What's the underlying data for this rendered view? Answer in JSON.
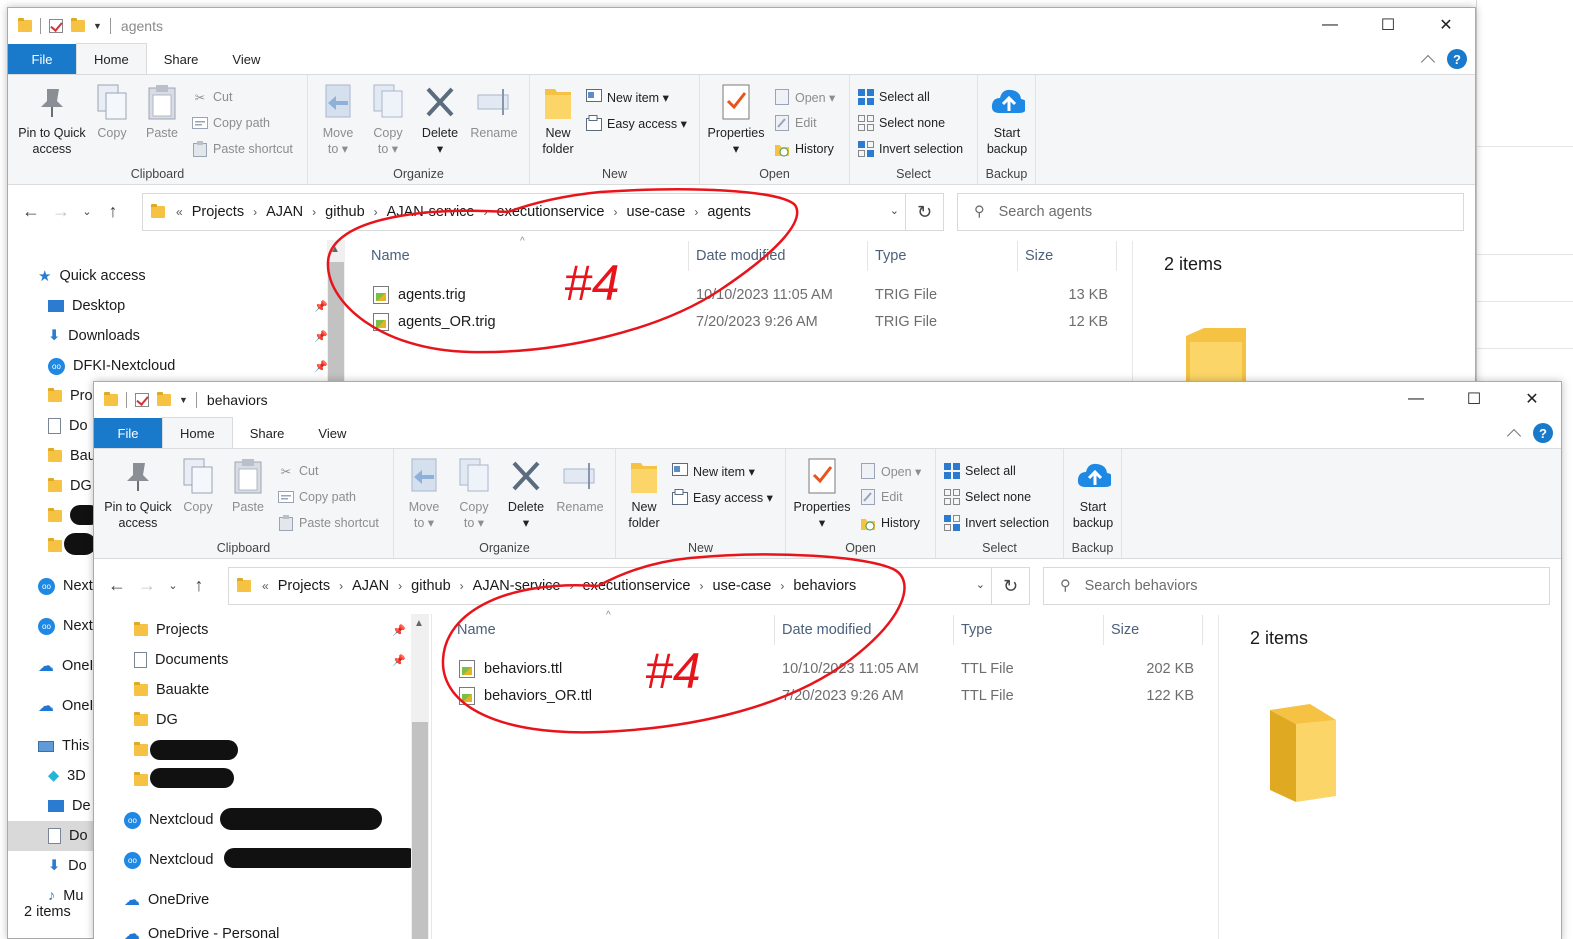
{
  "windows": [
    {
      "title": "agents",
      "tabs": [
        "File",
        "Home",
        "Share",
        "View"
      ],
      "ribbon": {
        "clipboard": {
          "label": "Clipboard",
          "pin": "Pin to Quick\naccess",
          "copy": "Copy",
          "paste": "Paste",
          "cut": "Cut",
          "copy_path": "Copy path",
          "paste_shortcut": "Paste shortcut"
        },
        "organize": {
          "label": "Organize",
          "move_to": "Move\nto ▾",
          "copy_to": "Copy\nto ▾",
          "delete": "Delete\n▾",
          "rename": "Rename"
        },
        "new": {
          "label": "New",
          "new_folder": "New\nfolder",
          "new_item": "New item ▾",
          "easy_access": "Easy access ▾"
        },
        "open": {
          "label": "Open",
          "properties": "Properties\n▾",
          "open": "Open ▾",
          "edit": "Edit",
          "history": "History"
        },
        "select": {
          "label": "Select",
          "select_all": "Select all",
          "select_none": "Select none",
          "invert_selection": "Invert selection"
        },
        "backup": {
          "label": "Backup",
          "start_backup": "Start\nbackup"
        }
      },
      "breadcrumb_prefix": "«",
      "breadcrumbs": [
        "Projects",
        "AJAN",
        "github",
        "AJAN-service",
        "executionservice",
        "use-case",
        "agents"
      ],
      "search_placeholder": "Search agents",
      "columns": [
        "Name",
        "Date modified",
        "Type",
        "Size"
      ],
      "files": [
        {
          "name": "agents.trig",
          "date": "10/10/2023 11:05 AM",
          "type": "TRIG File",
          "size": "13 KB"
        },
        {
          "name": "agents_OR.trig",
          "date": "7/20/2023 9:26 AM",
          "type": "TRIG File",
          "size": "12 KB"
        }
      ],
      "item_count": "2 items",
      "nav": [
        {
          "label": "Quick access",
          "icon": "star-icon"
        },
        {
          "label": "Desktop",
          "icon": "desktop-icon",
          "pinned": true
        },
        {
          "label": "Downloads",
          "icon": "download-icon",
          "pinned": true
        },
        {
          "label": "DFKI-Nextcloud",
          "icon": "nextcloud-icon",
          "pinned": true
        },
        {
          "label": "Pro",
          "icon": "folder-icon"
        },
        {
          "label": "Do",
          "icon": "document-icon"
        },
        {
          "label": "Bau",
          "icon": "folder-icon"
        },
        {
          "label": "DG",
          "icon": "folder-icon"
        },
        {
          "label": "",
          "icon": "folder-icon"
        },
        {
          "label": "",
          "icon": "folder-icon"
        },
        {
          "label": "Next",
          "icon": "nextcloud-icon"
        },
        {
          "label": "Next",
          "icon": "nextcloud-icon"
        },
        {
          "label": "OneI",
          "icon": "onedrive-icon"
        },
        {
          "label": "OneI",
          "icon": "onedrive-icon"
        },
        {
          "label": "This",
          "icon": "computer-icon"
        },
        {
          "label": "3D",
          "icon": "cube-icon"
        },
        {
          "label": "De",
          "icon": "desktop-icon"
        },
        {
          "label": "Do",
          "icon": "document-icon"
        },
        {
          "label": "Do",
          "icon": "download-icon"
        },
        {
          "label": "Mu",
          "icon": "music-icon"
        }
      ],
      "status": "2 items"
    },
    {
      "title": "behaviors",
      "tabs": [
        "File",
        "Home",
        "Share",
        "View"
      ],
      "ribbon": {
        "clipboard": {
          "label": "Clipboard",
          "pin": "Pin to Quick\naccess",
          "copy": "Copy",
          "paste": "Paste",
          "cut": "Cut",
          "copy_path": "Copy path",
          "paste_shortcut": "Paste shortcut"
        },
        "organize": {
          "label": "Organize",
          "move_to": "Move\nto ▾",
          "copy_to": "Copy\nto ▾",
          "delete": "Delete\n▾",
          "rename": "Rename"
        },
        "new": {
          "label": "New",
          "new_folder": "New\nfolder",
          "new_item": "New item ▾",
          "easy_access": "Easy access ▾"
        },
        "open": {
          "label": "Open",
          "properties": "Properties\n▾",
          "open": "Open ▾",
          "edit": "Edit",
          "history": "History"
        },
        "select": {
          "label": "Select",
          "select_all": "Select all",
          "select_none": "Select none",
          "invert_selection": "Invert selection"
        },
        "backup": {
          "label": "Backup",
          "start_backup": "Start\nbackup"
        }
      },
      "breadcrumb_prefix": "«",
      "breadcrumbs": [
        "Projects",
        "AJAN",
        "github",
        "AJAN-service",
        "executionservice",
        "use-case",
        "behaviors"
      ],
      "search_placeholder": "Search behaviors",
      "columns": [
        "Name",
        "Date modified",
        "Type",
        "Size"
      ],
      "files": [
        {
          "name": "behaviors.ttl",
          "date": "10/10/2023 11:05 AM",
          "type": "TTL File",
          "size": "202 KB"
        },
        {
          "name": "behaviors_OR.ttl",
          "date": "7/20/2023 9:26 AM",
          "type": "TTL File",
          "size": "122 KB"
        }
      ],
      "item_count": "2 items",
      "nav": [
        {
          "label": "Projects",
          "icon": "folder-icon",
          "pinned": true
        },
        {
          "label": "Documents",
          "icon": "document-icon",
          "pinned": true
        },
        {
          "label": "Bauakte",
          "icon": "folder-icon"
        },
        {
          "label": "DG",
          "icon": "folder-icon"
        },
        {
          "label": "",
          "icon": "folder-icon"
        },
        {
          "label": "",
          "icon": "folder-icon"
        },
        {
          "label": "Nextcloud",
          "icon": "nextcloud-icon"
        },
        {
          "label": "Nextcloud",
          "icon": "nextcloud-icon"
        },
        {
          "label": "OneDrive",
          "icon": "onedrive-icon"
        },
        {
          "label": "OneDrive - Personal",
          "icon": "onedrive-icon"
        }
      ]
    }
  ],
  "annotations": [
    "#4",
    "#4"
  ],
  "colors": {
    "accent": "#1979ca",
    "annotation": "#e8141b",
    "folder": "#f5c243"
  }
}
